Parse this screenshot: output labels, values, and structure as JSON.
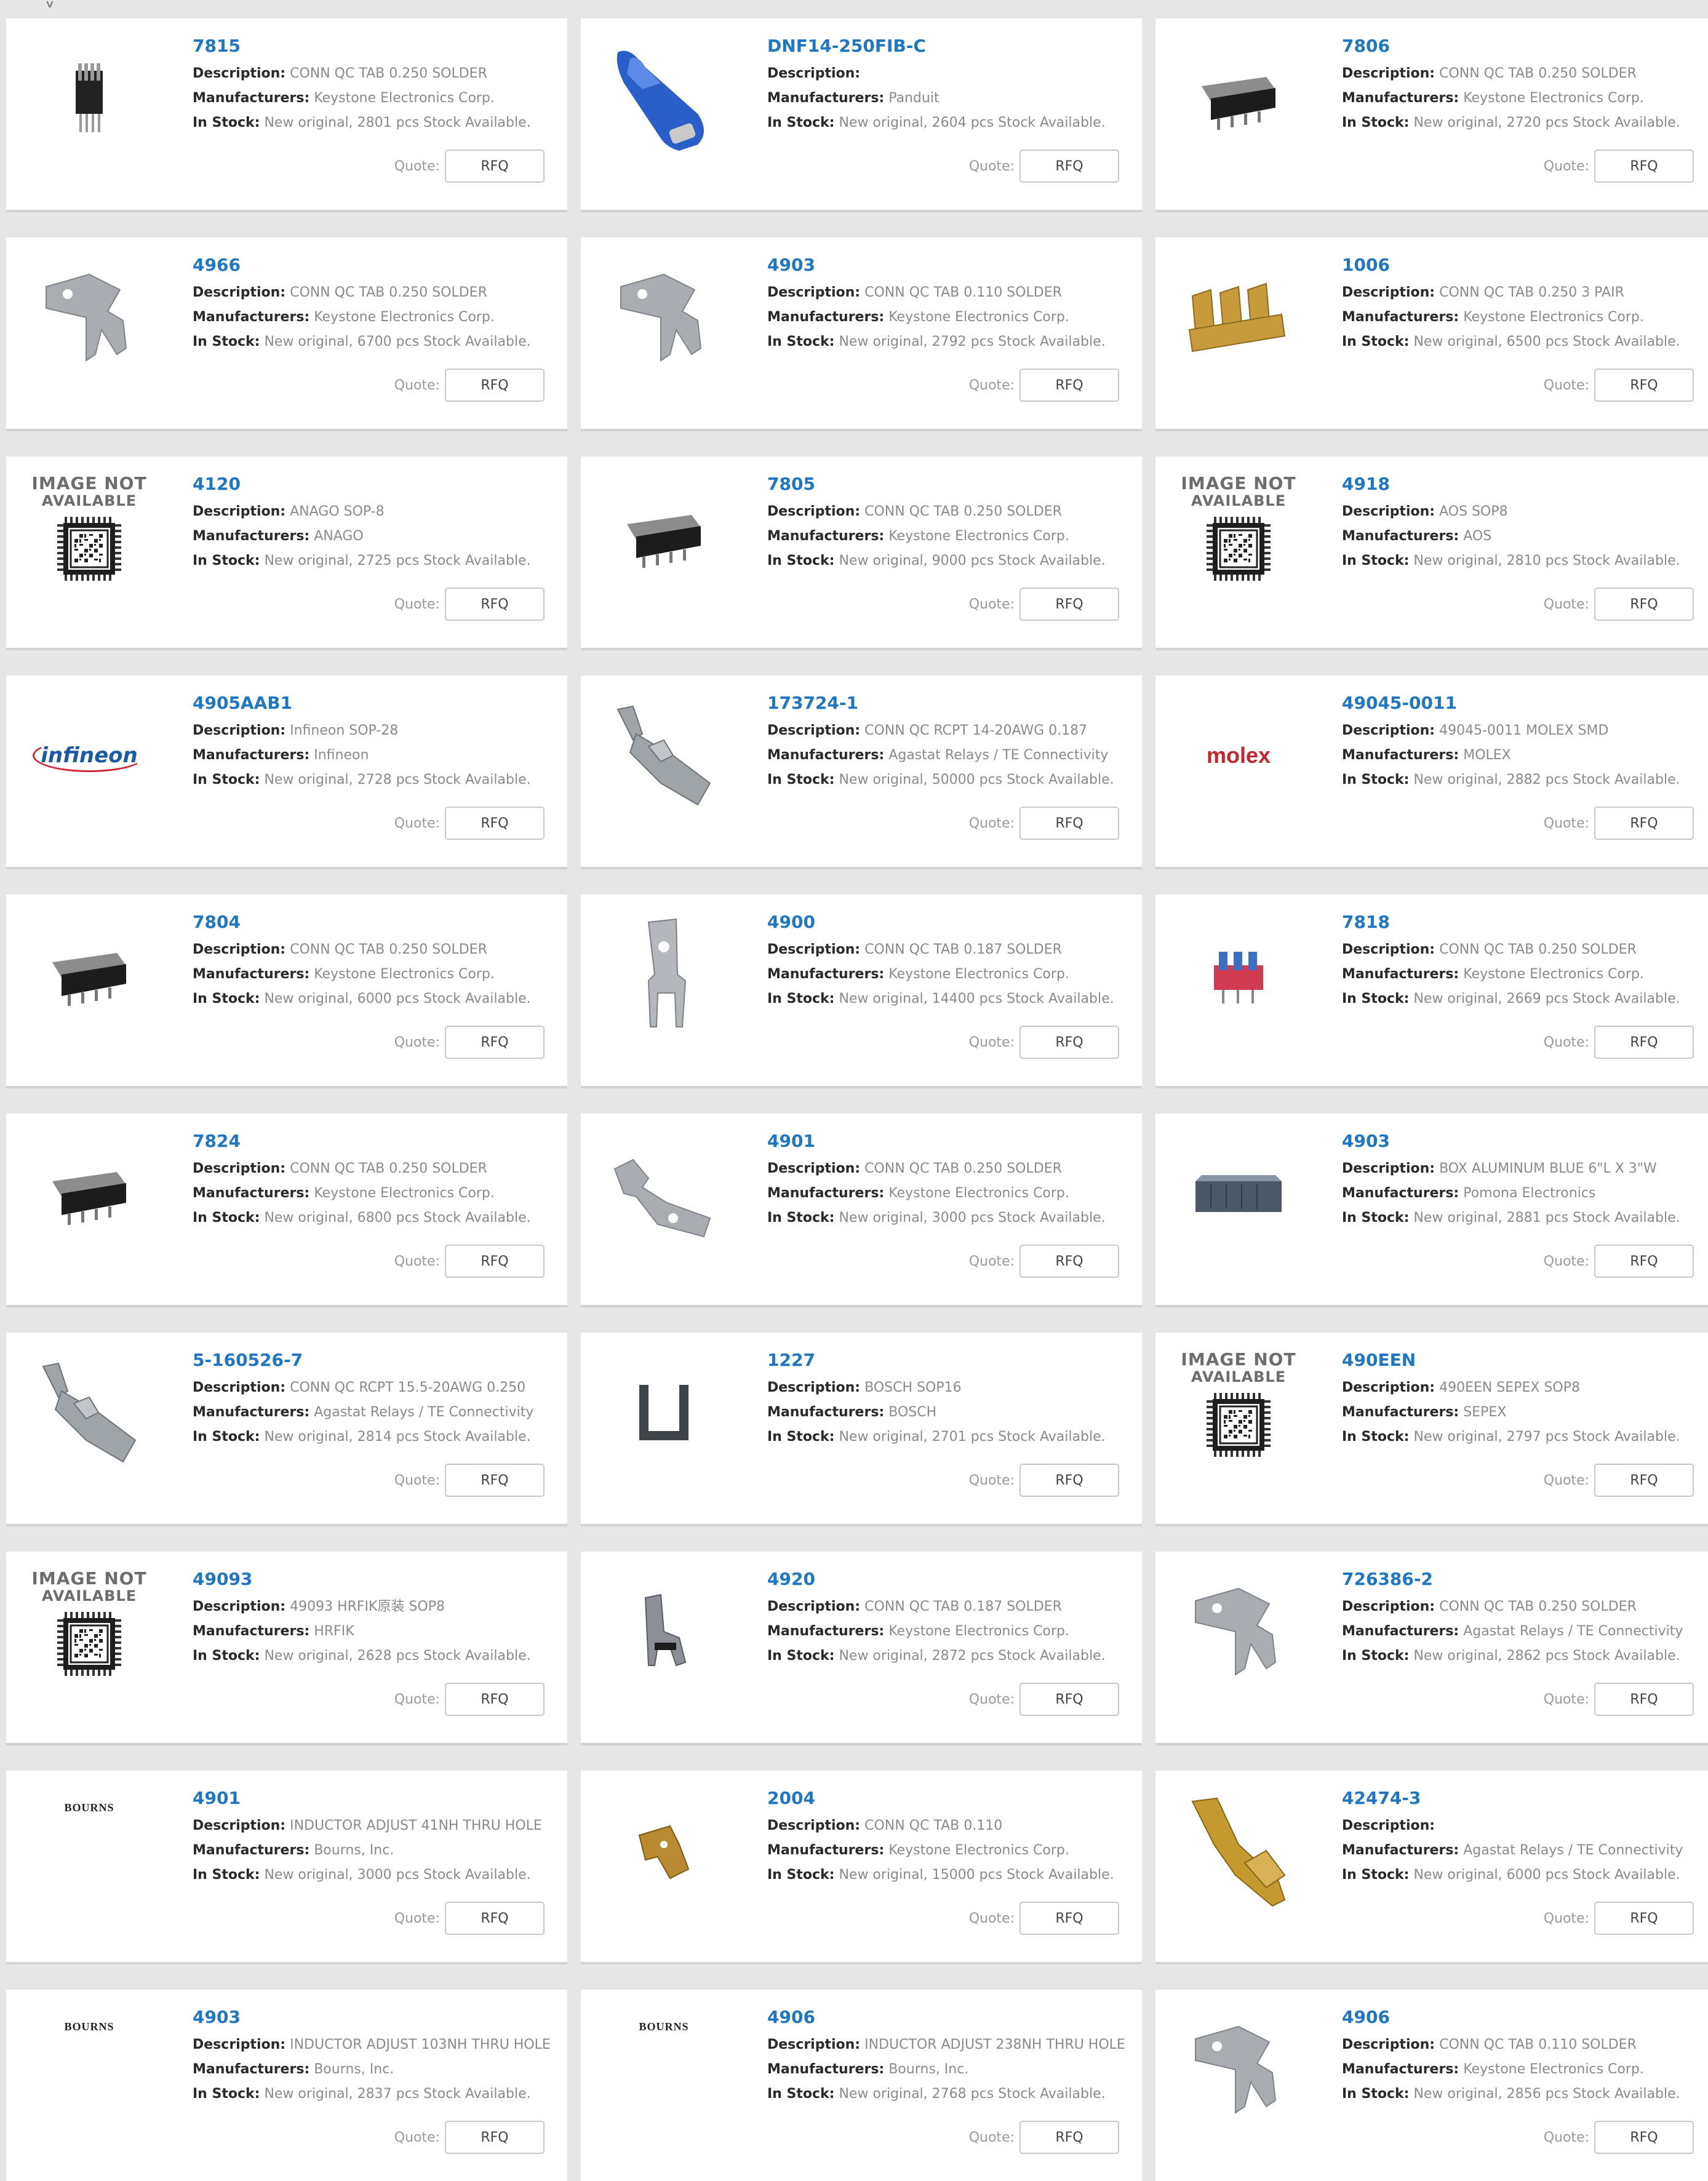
{
  "page": {
    "top_fragment": "y"
  },
  "labels": {
    "description": "Description:",
    "manufacturers": "Manufacturers:",
    "in_stock": "In Stock:",
    "quote": "Quote:",
    "rfq": "RFQ",
    "image_not_available_line1": "IMAGE NOT",
    "image_not_available_line2": "AVAILABLE"
  },
  "colors": {
    "page_background": "#e6e6e6",
    "part_number_link": "#1f76c2",
    "card_background": "#ffffff"
  },
  "products": [
    {
      "part": "7815",
      "description": "CONN QC TAB 0.250 SOLDER",
      "manufacturer": "Keystone Electronics Corp.",
      "stock": "New original, 2801 pcs Stock Available.",
      "image": "connector-vertical-icon"
    },
    {
      "part": "DNF14-250FIB-C",
      "description": "",
      "manufacturer": "Panduit",
      "stock": "New original, 2604 pcs Stock Available.",
      "image": "blue-terminal-icon"
    },
    {
      "part": "7806",
      "description": "CONN QC TAB 0.250 SOLDER",
      "manufacturer": "Keystone Electronics Corp.",
      "stock": "New original, 2720 pcs Stock Available.",
      "image": "black-connector-icon"
    },
    {
      "part": "4966",
      "description": "CONN QC TAB 0.250 SOLDER",
      "manufacturer": "Keystone Electronics Corp.",
      "stock": "New original, 6700 pcs Stock Available.",
      "image": "metal-tab-icon"
    },
    {
      "part": "4903",
      "description": "CONN QC TAB 0.110 SOLDER",
      "manufacturer": "Keystone Electronics Corp.",
      "stock": "New original, 2792 pcs Stock Available.",
      "image": "metal-tab-icon"
    },
    {
      "part": "1006",
      "description": "CONN QC TAB 0.250 3 PAIR",
      "manufacturer": "Keystone Electronics Corp.",
      "stock": "New original, 6500 pcs Stock Available.",
      "image": "brass-tabs-icon"
    },
    {
      "part": "4120",
      "description": "ANAGO SOP-8",
      "manufacturer": "ANAGO",
      "stock": "New original, 2725 pcs Stock Available.",
      "image": "image-not-available"
    },
    {
      "part": "7805",
      "description": "CONN QC TAB 0.250 SOLDER",
      "manufacturer": "Keystone Electronics Corp.",
      "stock": "New original, 9000 pcs Stock Available.",
      "image": "black-connector-icon"
    },
    {
      "part": "4918",
      "description": "AOS SOP8",
      "manufacturer": "AOS",
      "stock": "New original, 2810 pcs Stock Available.",
      "image": "image-not-available"
    },
    {
      "part": "4905AAB1",
      "description": "Infineon SOP-28",
      "manufacturer": "Infineon",
      "stock": "New original, 2728 pcs Stock Available.",
      "image": "infineon-logo"
    },
    {
      "part": "173724-1",
      "description": "CONN QC RCPT 14-20AWG 0.187",
      "manufacturer": "Agastat Relays / TE Connectivity",
      "stock": "New original, 50000 pcs Stock Available.",
      "image": "receptacle-icon"
    },
    {
      "part": "49045-0011",
      "description": "49045-0011 MOLEX SMD",
      "manufacturer": "MOLEX",
      "stock": "New original, 2882 pcs Stock Available.",
      "image": "molex-logo"
    },
    {
      "part": "7804",
      "description": "CONN QC TAB 0.250 SOLDER",
      "manufacturer": "Keystone Electronics Corp.",
      "stock": "New original, 6000 pcs Stock Available.",
      "image": "black-connector-icon"
    },
    {
      "part": "4900",
      "description": "CONN QC TAB 0.187 SOLDER",
      "manufacturer": "Keystone Electronics Corp.",
      "stock": "New original, 14400 pcs Stock Available.",
      "image": "upright-tab-icon"
    },
    {
      "part": "7818",
      "description": "CONN QC TAB 0.250 SOLDER",
      "manufacturer": "Keystone Electronics Corp.",
      "stock": "New original, 2669 pcs Stock Available.",
      "image": "red-connector-icon"
    },
    {
      "part": "7824",
      "description": "CONN QC TAB 0.250 SOLDER",
      "manufacturer": "Keystone Electronics Corp.",
      "stock": "New original, 6800 pcs Stock Available.",
      "image": "black-connector-icon"
    },
    {
      "part": "4901",
      "description": "CONN QC TAB 0.250 SOLDER",
      "manufacturer": "Keystone Electronics Corp.",
      "stock": "New original, 3000 pcs Stock Available.",
      "image": "flat-tab-icon"
    },
    {
      "part": "4903",
      "description": "BOX ALUMINUM BLUE 6\"L X 3\"W",
      "manufacturer": "Pomona Electronics",
      "stock": "New original, 2881 pcs Stock Available.",
      "image": "aluminum-box-icon"
    },
    {
      "part": "5-160526-7",
      "description": "CONN QC RCPT 15.5-20AWG 0.250",
      "manufacturer": "Agastat Relays / TE Connectivity",
      "stock": "New original, 2814 pcs Stock Available.",
      "image": "receptacle-icon"
    },
    {
      "part": "1227",
      "description": "BOSCH SOP16",
      "manufacturer": "BOSCH",
      "stock": "New original, 2701 pcs Stock Available.",
      "image": "u-clip-icon"
    },
    {
      "part": "490EEN",
      "description": "490EEN SEPEX SOP8",
      "manufacturer": "SEPEX",
      "stock": "New original, 2797 pcs Stock Available.",
      "image": "image-not-available"
    },
    {
      "part": "49093",
      "description": "49093 HRFIK原装 SOP8",
      "manufacturer": "HRFIK",
      "stock": "New original, 2628 pcs Stock Available.",
      "image": "image-not-available"
    },
    {
      "part": "4920",
      "description": "CONN QC TAB 0.187 SOLDER",
      "manufacturer": "Keystone Electronics Corp.",
      "stock": "New original, 2872 pcs Stock Available.",
      "image": "small-tab-icon"
    },
    {
      "part": "726386-2",
      "description": "CONN QC TAB 0.250 SOLDER",
      "manufacturer": "Agastat Relays / TE Connectivity",
      "stock": "New original, 2862 pcs Stock Available.",
      "image": "metal-tab-icon"
    },
    {
      "part": "4901",
      "description": "INDUCTOR ADJUST 41NH THRU HOLE",
      "manufacturer": "Bourns, Inc.",
      "stock": "New original, 3000 pcs Stock Available.",
      "image": "bourns-logo"
    },
    {
      "part": "2004",
      "description": "CONN QC TAB 0.110",
      "manufacturer": "Keystone Electronics Corp.",
      "stock": "New original, 15000 pcs Stock Available.",
      "image": "brass-small-tab-icon"
    },
    {
      "part": "42474-3",
      "description": "",
      "manufacturer": "Agastat Relays / TE Connectivity",
      "stock": "New original, 6000 pcs Stock Available.",
      "image": "brass-terminal-icon"
    },
    {
      "part": "4903",
      "description": "INDUCTOR ADJUST 103NH THRU HOLE",
      "manufacturer": "Bourns, Inc.",
      "stock": "New original, 2837 pcs Stock Available.",
      "image": "bourns-logo"
    },
    {
      "part": "4906",
      "description": "INDUCTOR ADJUST 238NH THRU HOLE",
      "manufacturer": "Bourns, Inc.",
      "stock": "New original, 2768 pcs Stock Available.",
      "image": "bourns-logo"
    },
    {
      "part": "4906",
      "description": "CONN QC TAB 0.110 SOLDER",
      "manufacturer": "Keystone Electronics Corp.",
      "stock": "New original, 2856 pcs Stock Available.",
      "image": "metal-tab-icon"
    }
  ],
  "logos": {
    "infineon": "infineon",
    "molex": "molex",
    "bourns": "BOURNS"
  }
}
